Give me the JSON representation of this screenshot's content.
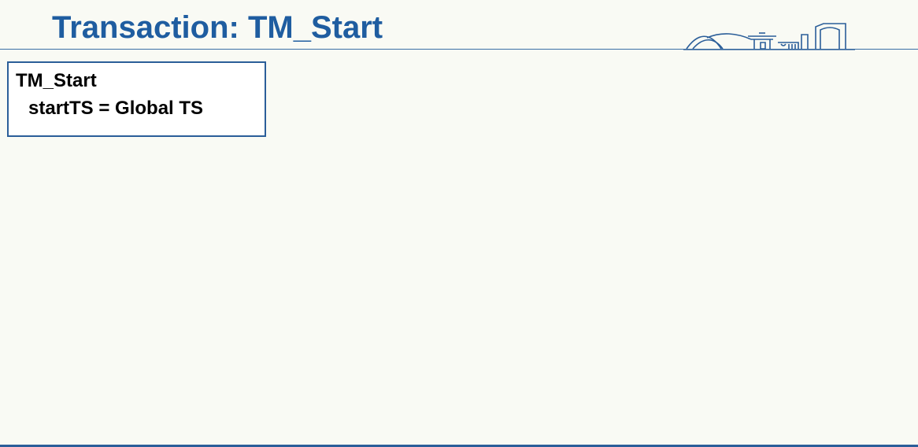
{
  "slide": {
    "title": "Transaction: TM_Start",
    "accent_color": "#1f5da0"
  },
  "code_box": {
    "lines": [
      "TM_Start",
      "startTS = Global TS"
    ]
  },
  "logo": {
    "icon": "campus-skyline-icon"
  }
}
